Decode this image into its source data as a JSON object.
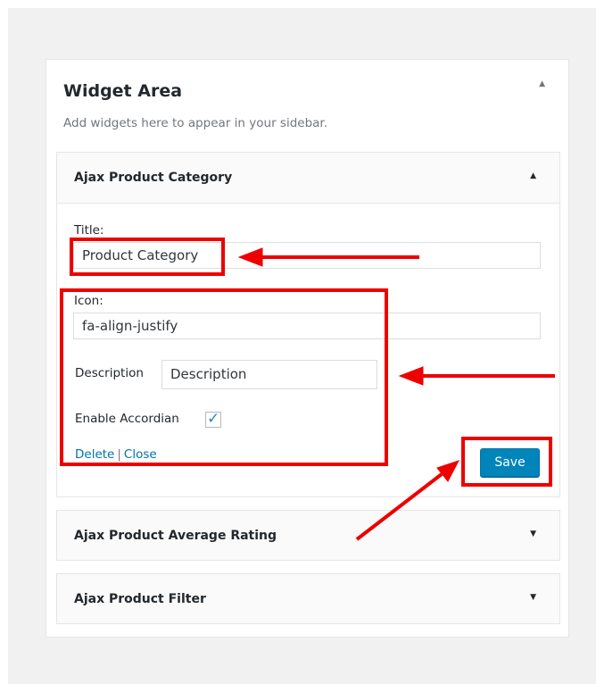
{
  "widget_area": {
    "title": "Widget Area",
    "description": "Add widgets here to appear in your sidebar."
  },
  "widgets": [
    {
      "title": "Ajax Product Category",
      "expanded": true,
      "form": {
        "title_label": "Title:",
        "title_value": "Product Category",
        "icon_label": "Icon:",
        "icon_value": "fa-align-justify",
        "description_label": "Description",
        "description_value": "Description",
        "accordian_label": "Enable Accordian",
        "accordian_checked": true,
        "delete_label": "Delete",
        "separator": "|",
        "close_label": "Close",
        "save_label": "Save"
      }
    },
    {
      "title": "Ajax Product Average Rating",
      "expanded": false
    },
    {
      "title": "Ajax Product Filter",
      "expanded": false
    }
  ],
  "icons": {
    "collapse": "caret-up-icon",
    "expand": "caret-down-icon",
    "check": "checkmark-icon"
  },
  "colors": {
    "annotation": "#ee0000",
    "primary_button": "#0085ba",
    "link": "#0073aa"
  }
}
